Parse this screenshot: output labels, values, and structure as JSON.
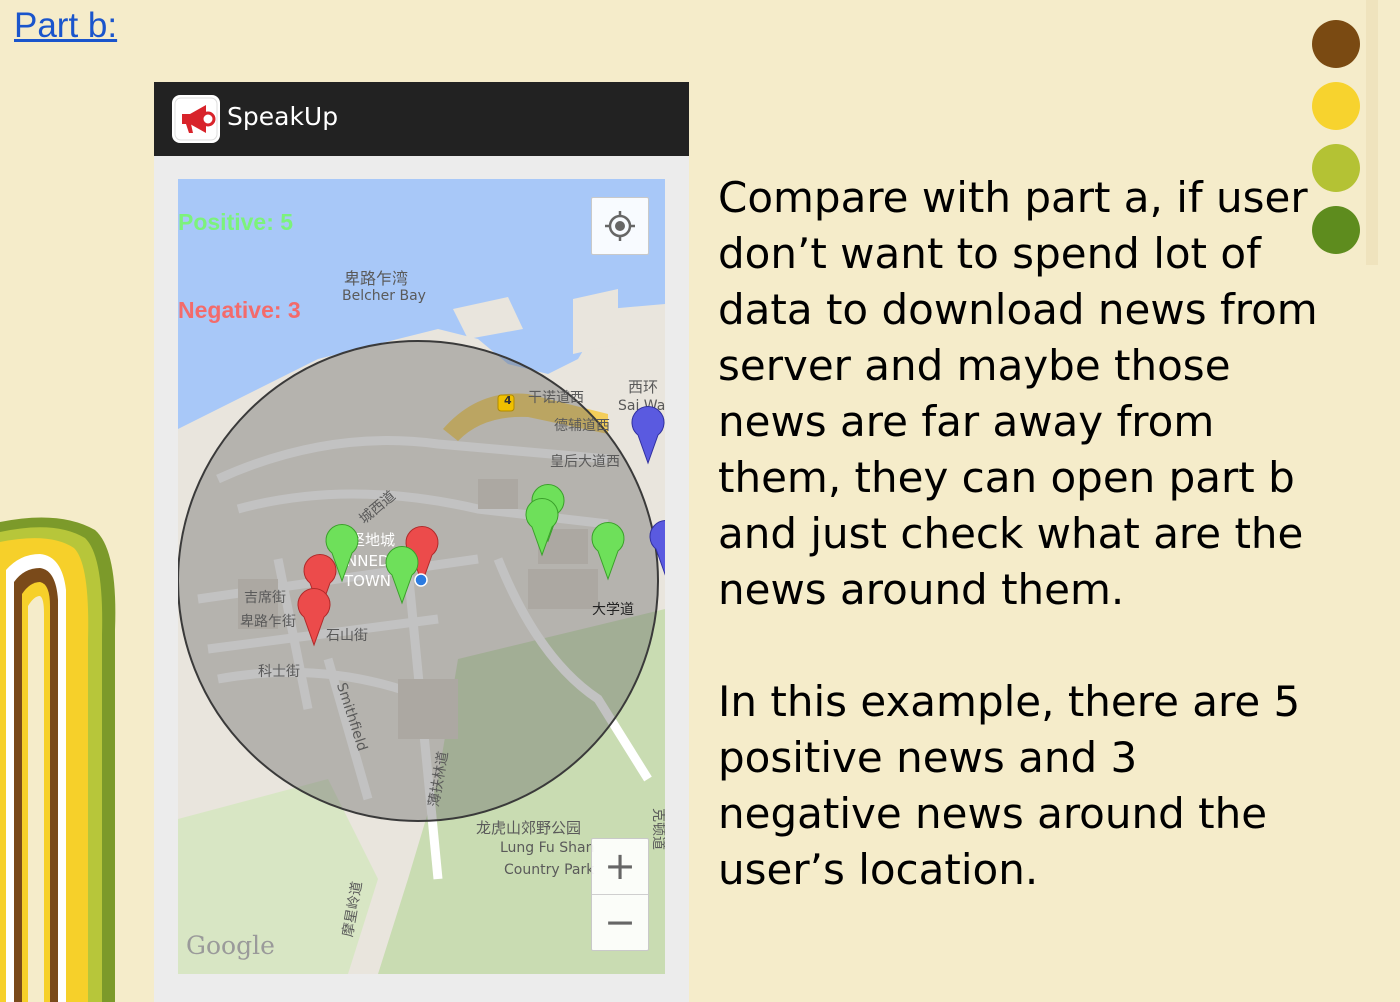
{
  "slide": {
    "link_text": "Part b:",
    "paragraph1": "Compare with part a, if user don’t want to spend lot of data to download news from server and maybe those news are far away from them, they can open part b and just check what are the news around them.",
    "paragraph2": "In this example, there are 5 positive news and 3 negative news around the user’s location."
  },
  "app": {
    "title": "SpeakUp",
    "icon": "megaphone-icon"
  },
  "map": {
    "positive_label": "Positive: 5",
    "negative_label": "Negative: 3",
    "positive_count": 5,
    "negative_count": 3,
    "attribution": "Google",
    "zoom_in": "+",
    "zoom_out": "−",
    "labels": {
      "belcher_cn": "卑路乍湾",
      "belcher_en": "Belcher Bay",
      "connaught_west": "干诺道西",
      "des_voeux_west": "德辅道西",
      "queens_road_west": "皇后大道西",
      "sai_wan_cn": "西环",
      "sai_wan_en": "Sai Wa",
      "shing_sai": "城西道",
      "kennedy_cn": "坚地城",
      "kennedy_en1": "NNED",
      "kennedy_en2": "TOWN",
      "cadogan": "吉席街",
      "belcher_st": "卑路乍街",
      "sands_st": "石山街",
      "davis_st": "科士街",
      "smithfield": "Smithfield",
      "university": "大学道",
      "pok_fu_lam": "薄扶林道",
      "lung_fu_shan_cn": "龙虎山郊野公园",
      "lung_fu_shan_en1": "Lung Fu Shan",
      "lung_fu_shan_en2": "Country Park",
      "mount_davis": "摩星岭道",
      "conduit": "克顿道",
      "route_number": "4"
    },
    "colors": {
      "positive": "#7cf27c",
      "negative": "#f36b6b",
      "pin_green": "#6ee05a",
      "pin_red": "#ec4b4b",
      "pin_blue": "#5a5ae0",
      "water": "#a8c8f8",
      "park": "#c8dcb0"
    }
  }
}
